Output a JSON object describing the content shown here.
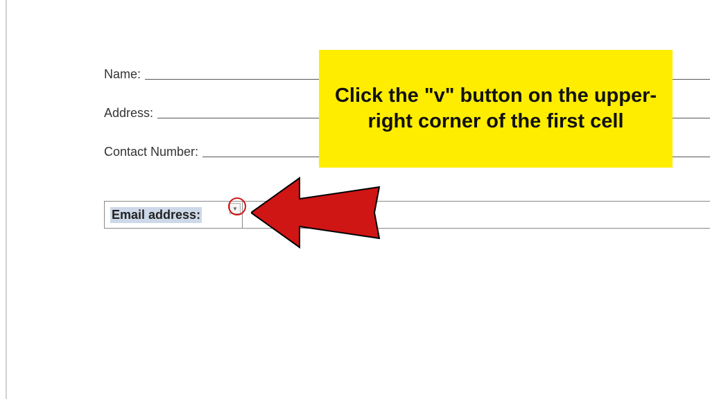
{
  "form": {
    "name_label": "Name:",
    "address_label": "Address:",
    "contact_label": "Contact Number:"
  },
  "table": {
    "email_label": "Email address:"
  },
  "callout": {
    "text": "Click the \"v\" button on the upper-right corner of the first cell"
  }
}
